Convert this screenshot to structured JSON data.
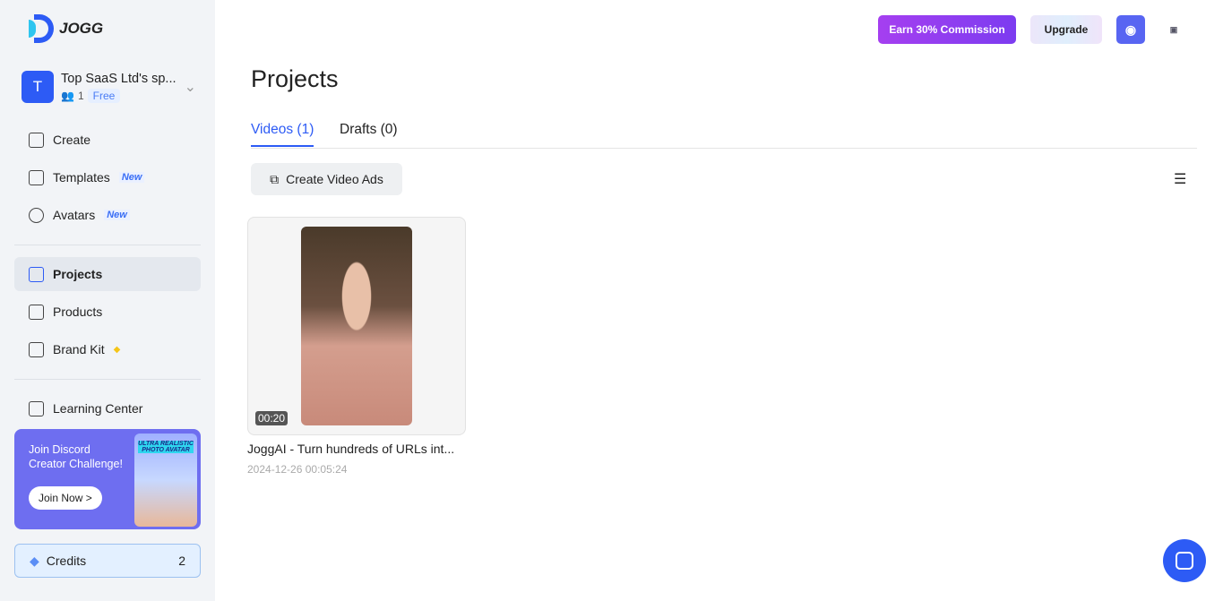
{
  "brand": "JOGG",
  "workspace": {
    "initial": "T",
    "name": "Top SaaS Ltd's sp...",
    "members": "1",
    "plan": "Free"
  },
  "nav": [
    {
      "label": "Create"
    },
    {
      "label": "Templates",
      "badge": "New"
    },
    {
      "label": "Avatars",
      "badge": "New"
    },
    {
      "label": "Projects"
    },
    {
      "label": "Products"
    },
    {
      "label": "Brand Kit"
    },
    {
      "label": "Learning Center"
    }
  ],
  "promo": {
    "text1": "Join Discord",
    "text2": "Creator Challenge!",
    "button": "Join Now >",
    "image_text": "ULTRA REALISTIC PHOTO AVATAR"
  },
  "credits": {
    "label": "Credits",
    "value": "2"
  },
  "header": {
    "commission": "Earn 30% Commission",
    "upgrade": "Upgrade"
  },
  "page": {
    "title": "Projects",
    "tabs": [
      "Videos (1)",
      "Drafts (0)"
    ],
    "create_button": "Create Video Ads"
  },
  "videos": [
    {
      "duration": "00:20",
      "title": "JoggAI - Turn hundreds of URLs int...",
      "date": "2024-12-26 00:05:24"
    }
  ]
}
